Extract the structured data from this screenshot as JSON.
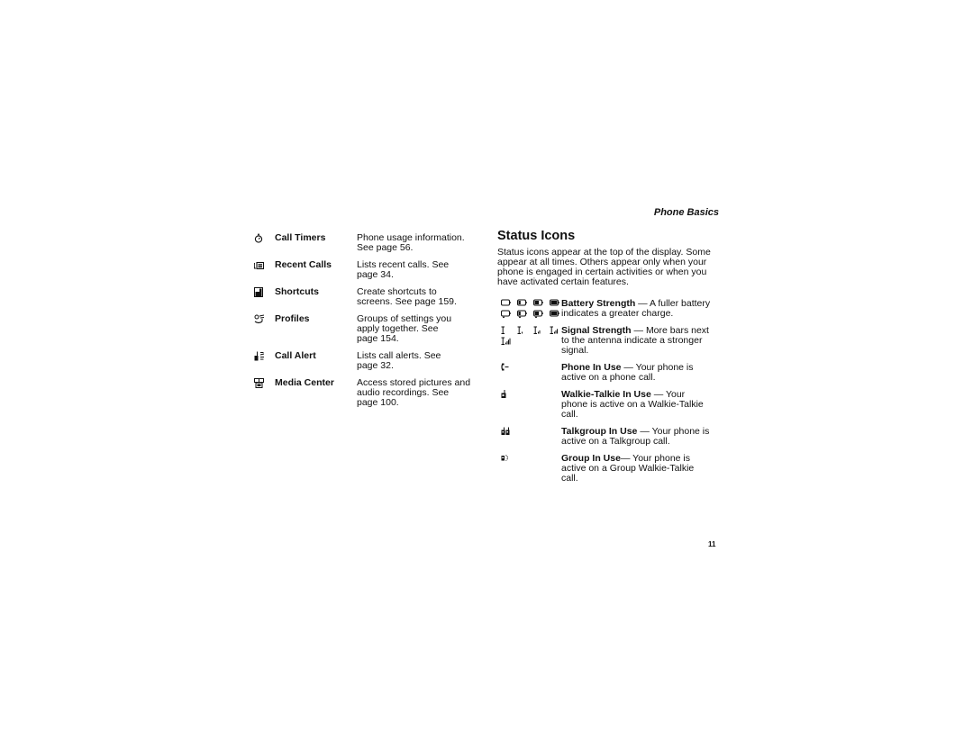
{
  "running_head": "Phone Basics",
  "menu_items": [
    {
      "icon": "stopwatch-icon",
      "label": "Call Timers",
      "desc_lines": [
        "Phone usage information.",
        "See page 56."
      ]
    },
    {
      "icon": "recent-calls-icon",
      "label": "Recent Calls",
      "desc_lines": [
        "Lists recent calls. See",
        "page 34."
      ]
    },
    {
      "icon": "shortcuts-icon",
      "label": "Shortcuts",
      "desc_lines": [
        "Create shortcuts to",
        "screens. See page 159."
      ]
    },
    {
      "icon": "profiles-icon",
      "label": "Profiles",
      "desc_lines": [
        "Groups of settings you",
        "apply together. See",
        "page 154."
      ]
    },
    {
      "icon": "call-alert-icon",
      "label": "Call Alert",
      "desc_lines": [
        "Lists call alerts. See",
        "page 32."
      ]
    },
    {
      "icon": "media-center-icon",
      "label": "Media Center",
      "desc_lines": [
        "Access stored pictures and",
        "audio recordings. See",
        "page 100."
      ]
    }
  ],
  "section": {
    "title": "Status Icons",
    "intro_lines": [
      "Status icons appear at the top of the display. Some",
      "appear at all times. Others appear only when your",
      "phone is engaged in certain activities or when you",
      "have activated certain features."
    ]
  },
  "status_items": [
    {
      "term": "Battery Strength",
      "sep": " — ",
      "lines": [
        "A fuller battery",
        "indicates a greater charge."
      ]
    },
    {
      "term": "Signal Strength",
      "sep": " — ",
      "lines": [
        "More bars next",
        "to the antenna indicate a stronger",
        "signal."
      ]
    },
    {
      "term": "Phone In Use",
      "sep": " — ",
      "lines": [
        "Your phone is",
        "active on a phone call."
      ]
    },
    {
      "term": "Walkie-Talkie In Use",
      "sep": " — ",
      "lines": [
        "Your",
        "phone is active on a Walkie-Talkie",
        "call."
      ]
    },
    {
      "term": "Talkgroup In Use",
      "sep": " — ",
      "lines": [
        "Your phone is",
        "active on a Talkgroup call."
      ]
    },
    {
      "term": "Group In Use",
      "sep": "— ",
      "lines": [
        "Your phone is",
        "active on a Group Walkie-Talkie",
        "call."
      ]
    }
  ],
  "battery_levels": [
    0,
    0.33,
    0.66,
    1.0
  ],
  "signal_levels": [
    0,
    1,
    2,
    3,
    4
  ],
  "page_number": "11"
}
